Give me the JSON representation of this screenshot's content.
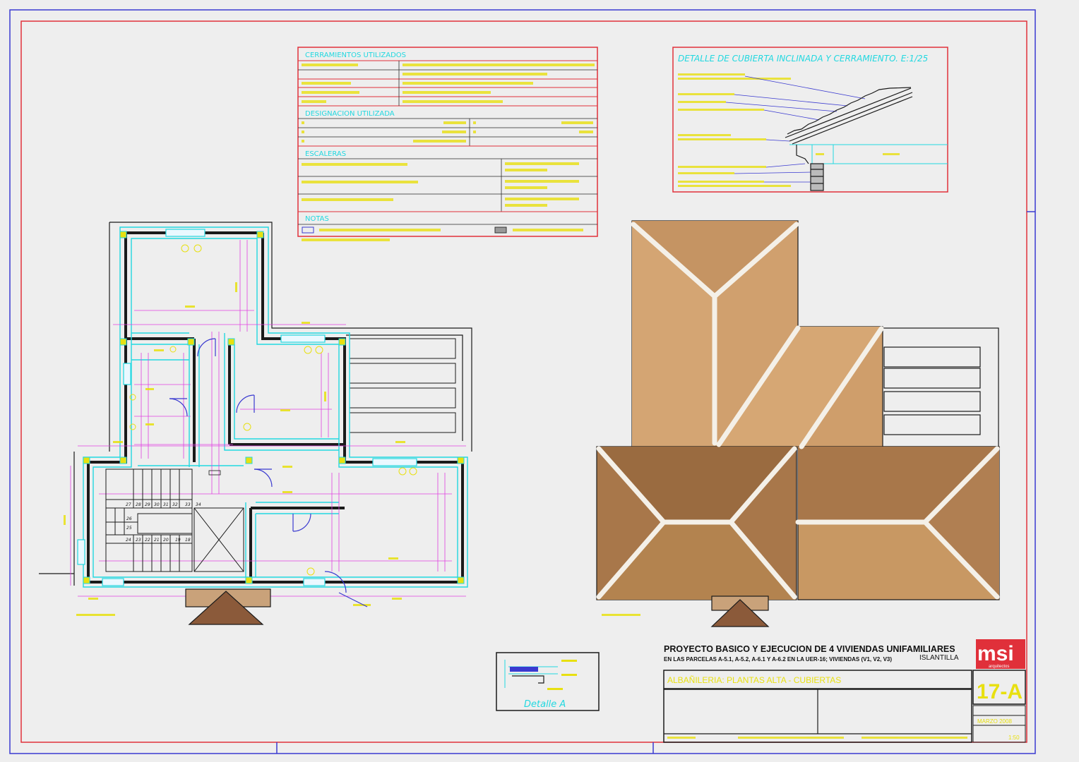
{
  "colors": {
    "frame_red": "#e0303a",
    "frame_blue": "#3a3ad0",
    "cyan": "#22d8e0",
    "yellow": "#e8e010",
    "magenta": "#e040e0",
    "wall_dark": "#1a1a1a",
    "roof_light": "#d0a06e",
    "roof_dark": "#a8774a",
    "ridge": "#f4f0e8"
  },
  "table": {
    "section1": "CERRAMIENTOS  UTILIZADOS",
    "section2": "DESIGNACION  UTILIZADA",
    "section3": "ESCALERAS",
    "section4": "NOTAS"
  },
  "detail_roof": {
    "title": "DETALLE  DE  CUBIERTA  INCLINADA  Y  CERRAMIENTO.   E:1/25"
  },
  "detail_a": {
    "label": "Detalle   A"
  },
  "stairs": {
    "top_row": [
      "27",
      "28",
      "29",
      "30",
      "31",
      "32",
      "33",
      "34"
    ],
    "mid_row": [
      "26",
      "25"
    ],
    "bottom_row": [
      "24",
      "23",
      "22",
      "21",
      "20",
      "19",
      "18"
    ]
  },
  "title_block": {
    "project_title": "PROYECTO BASICO Y EJECUCION DE 4 VIVIENDAS UNIFAMILIARES",
    "project_subtitle": "EN LAS PARCELAS A-5.1, A-5.2, A-6.1 Y A-6.2 EN LA UER-16; VIVIENDAS (V1, V2, V3)",
    "location": "ISLANTILLA",
    "logo_text": "msi",
    "logo_sub": "arquitectos",
    "sheet_title": "ALBAÑILERIA: PLANTAS ALTA - CUBIERTAS",
    "sheet_number": "17-A",
    "date": "MARZO 2008",
    "scale": "1:50"
  }
}
